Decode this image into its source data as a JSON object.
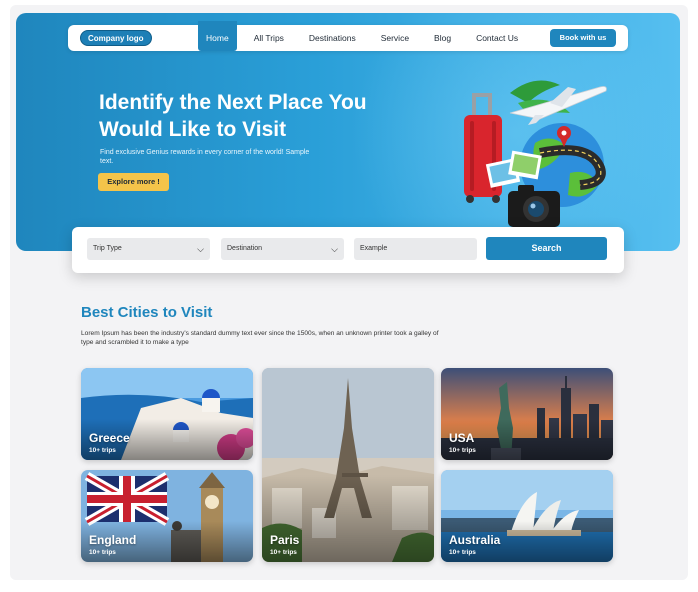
{
  "nav": {
    "logo": "Company logo",
    "items": [
      "Home",
      "All Trips",
      "Destinations",
      "Service",
      "Blog",
      "Contact Us"
    ],
    "active": "Home",
    "cta": "Book with us"
  },
  "hero": {
    "title": "Identify the Next Place You Would Like to Visit",
    "subtitle": "Find exclusive Genius rewards in every corner of the world! Sample text.",
    "button": "Explore more !"
  },
  "search": {
    "trip_type": "Trip Type",
    "destination": "Destination",
    "example_placeholder": "Example",
    "button": "Search"
  },
  "section": {
    "title": "Best Cities to Visit",
    "text": "Lorem Ipsum has been the industry's standard dummy text ever since the 1500s, when an unknown printer took a galley of type and scrambled it to make a type"
  },
  "cities": [
    {
      "name": "Greece",
      "trips": "10+ trips"
    },
    {
      "name": "Paris",
      "trips": "10+ trips"
    },
    {
      "name": "USA",
      "trips": "10+ trips"
    },
    {
      "name": "England",
      "trips": "10+ trips"
    },
    {
      "name": "Australia",
      "trips": "10+ trips"
    }
  ],
  "colors": {
    "primary": "#1f86bd",
    "accent": "#f4c44a",
    "background": "#f3f3f5"
  }
}
